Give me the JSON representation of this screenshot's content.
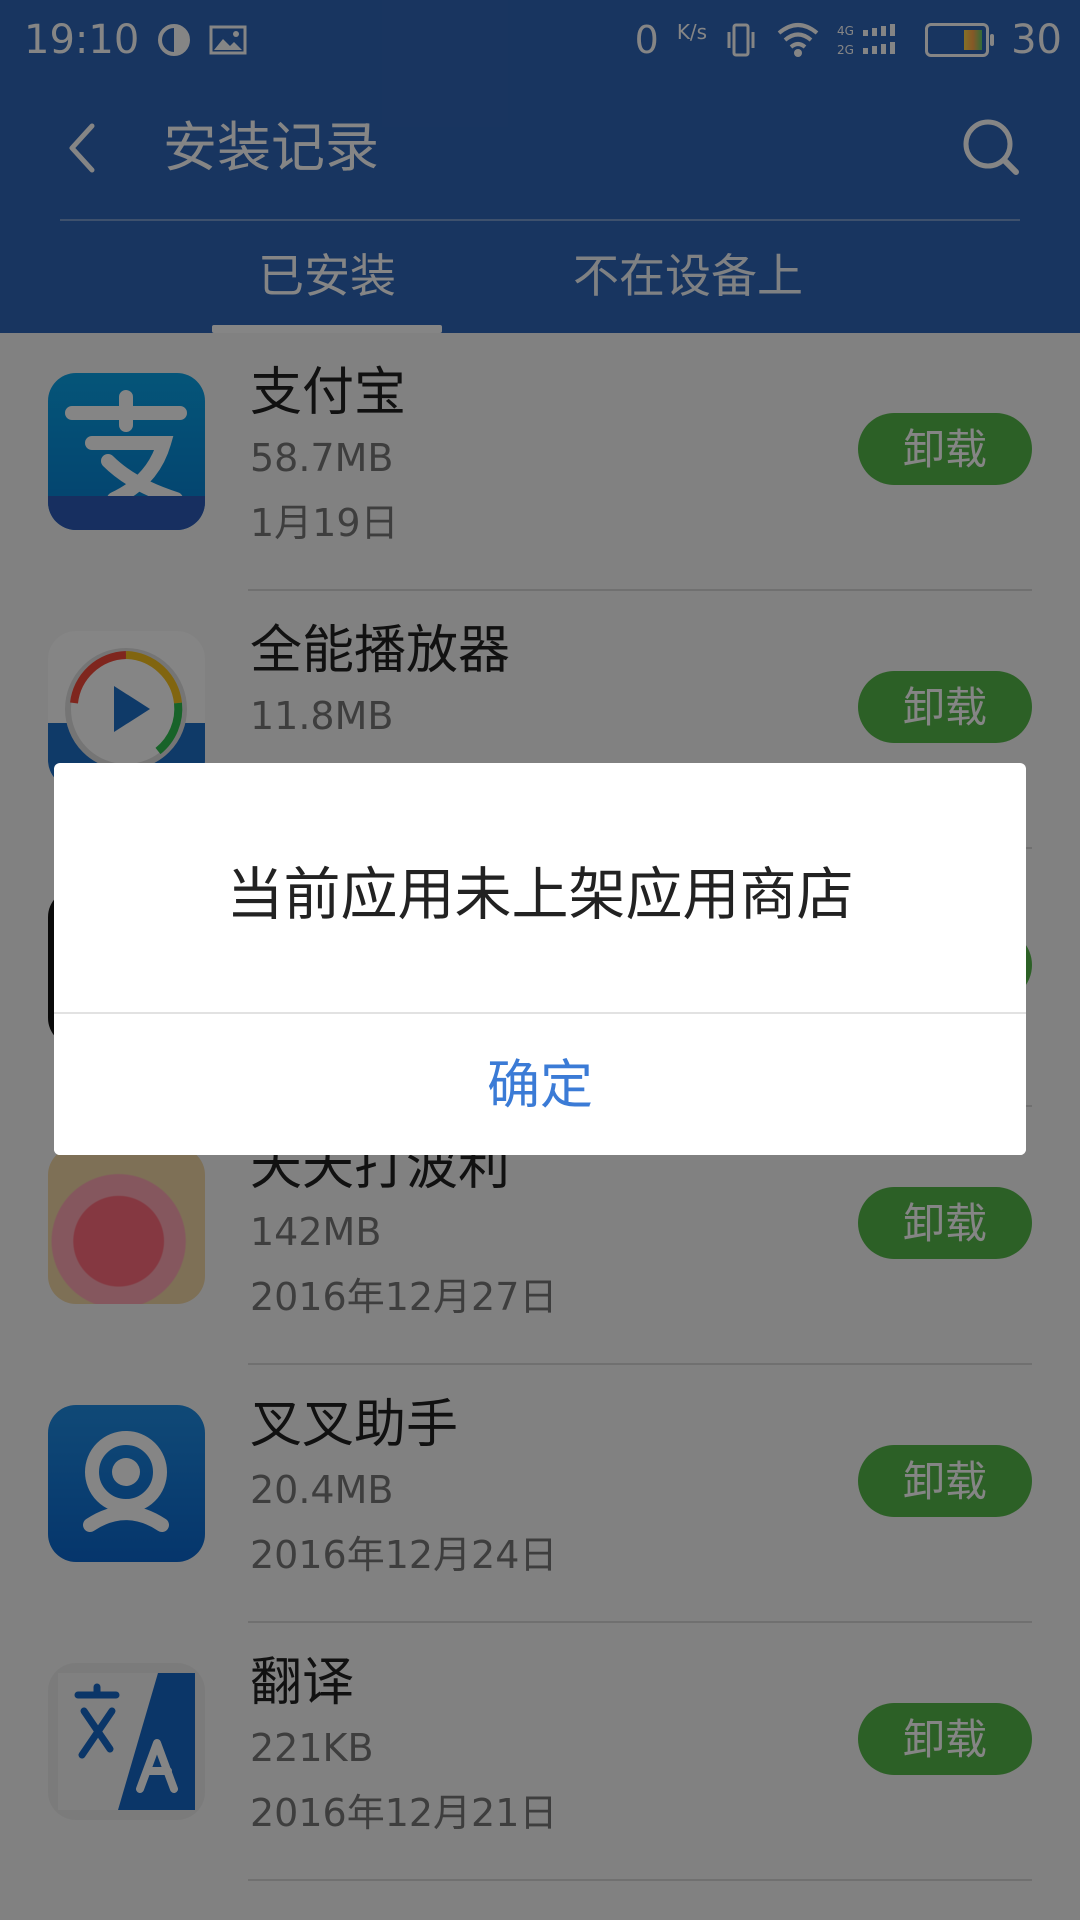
{
  "status_bar": {
    "time": "19:10",
    "net_speed": "0",
    "net_unit": "K/s",
    "battery_level": "30"
  },
  "header": {
    "title": "安装记录",
    "tabs": [
      {
        "label": "已安装",
        "active": true
      },
      {
        "label": "不在设备上",
        "active": false
      }
    ]
  },
  "apps": [
    {
      "name": "支付宝",
      "size": "58.7MB",
      "date": "1月19日",
      "action": "卸载",
      "icon": "alipay-icon"
    },
    {
      "name": "全能播放器",
      "size": "11.8MB",
      "date": "",
      "action": "卸载",
      "icon": "player-icon"
    },
    {
      "name": "",
      "size": "",
      "date": "",
      "action": "卸载",
      "icon": "app-icon"
    },
    {
      "name": "天天打波利",
      "size": "142MB",
      "date": "2016年12月27日",
      "action": "卸载",
      "icon": "game-icon"
    },
    {
      "name": "叉叉助手",
      "size": "20.4MB",
      "date": "2016年12月24日",
      "action": "卸载",
      "icon": "assistant-icon"
    },
    {
      "name": "翻译",
      "size": "221KB",
      "date": "2016年12月21日",
      "action": "卸载",
      "icon": "translate-icon"
    }
  ],
  "dialog": {
    "message": "当前应用未上架应用商店",
    "confirm": "确定"
  },
  "colors": {
    "brand_blue": "#2f66b9",
    "uninstall_green": "#55b84a",
    "dialog_link": "#3b7bd6"
  }
}
